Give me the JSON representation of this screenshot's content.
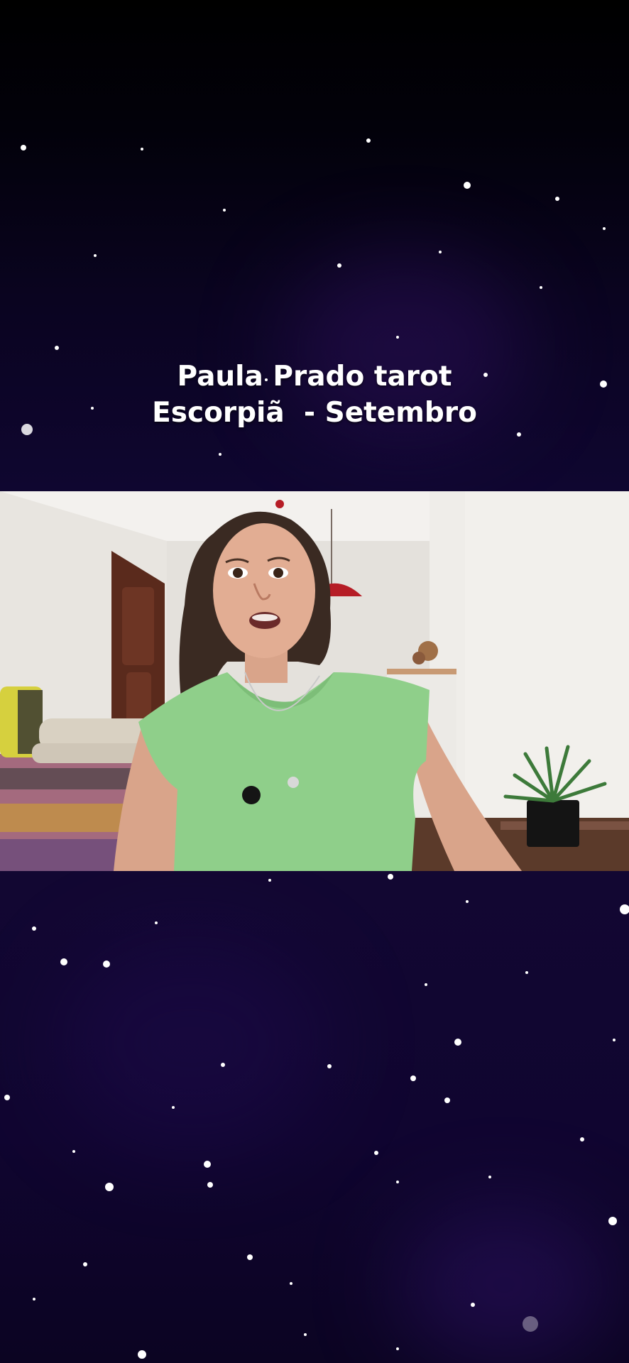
{
  "overlay": {
    "title_line1": "Paula Prado tarot",
    "title_line2": "Escorpiã  - Setembro"
  },
  "video": {
    "subject": "woman-speaking",
    "shirt_color": "#8fcf8a",
    "wall_color": "#ebe8e4",
    "door_color": "#5a2a1c"
  },
  "colors": {
    "sky_top": "#000000",
    "sky_bottom": "#120732",
    "text": "#ffffff"
  }
}
